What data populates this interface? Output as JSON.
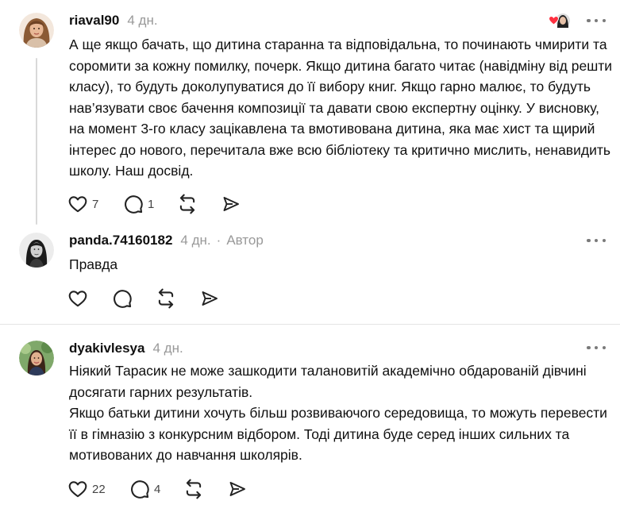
{
  "posts": [
    {
      "username": "riaval90",
      "time": "4 дн.",
      "text": "А ще якщо бачать, що дитина старанна та відповідальна, то починають чмирити та соромити за кожну помилку, почерк. Якщо дитина багато читає (навідміну від решти класу), то будуть доколупуватися до її вибору книг. Якщо гарно малює, то будуть нав’язувати своє бачення композиції та давати свою експертну оцінку. У висновку, на момент 3-го класу зацікавлена та вмотивована дитина, яка має хист та щирий інтерес до нового, перечитала вже всю бібліотеку та критично мислить, ненавидить школу. Наш досвід.",
      "likes": "7",
      "replies": "1"
    },
    {
      "username": "panda.74160182",
      "time": "4 дн.",
      "separator": "·",
      "role": "Автор",
      "text": "Правда"
    },
    {
      "username": "dyakivlesya",
      "time": "4 дн.",
      "paragraphs": [
        "Ніякий Тарасик не може зашкодити талановитій академічно обдарованій дівчині досягати гарних результатів.",
        "Якщо батьки дитини хочуть більш розвиваючого середовища, то можуть перевести її в гімназію з конкурсним відбором. Тоді дитина буде серед інших сильних та мотивованих до навчання школярів."
      ],
      "likes": "22",
      "replies": "4"
    }
  ],
  "icons": {
    "like": "heart-icon",
    "reply": "comment-icon",
    "repost": "repost-icon",
    "share": "share-icon",
    "more": "more-icon",
    "liked_by": "liked-by-author-icon"
  },
  "colors": {
    "text": "#101010",
    "muted": "#999999",
    "heart": "#ff3040",
    "divider": "#e5e5e5"
  }
}
